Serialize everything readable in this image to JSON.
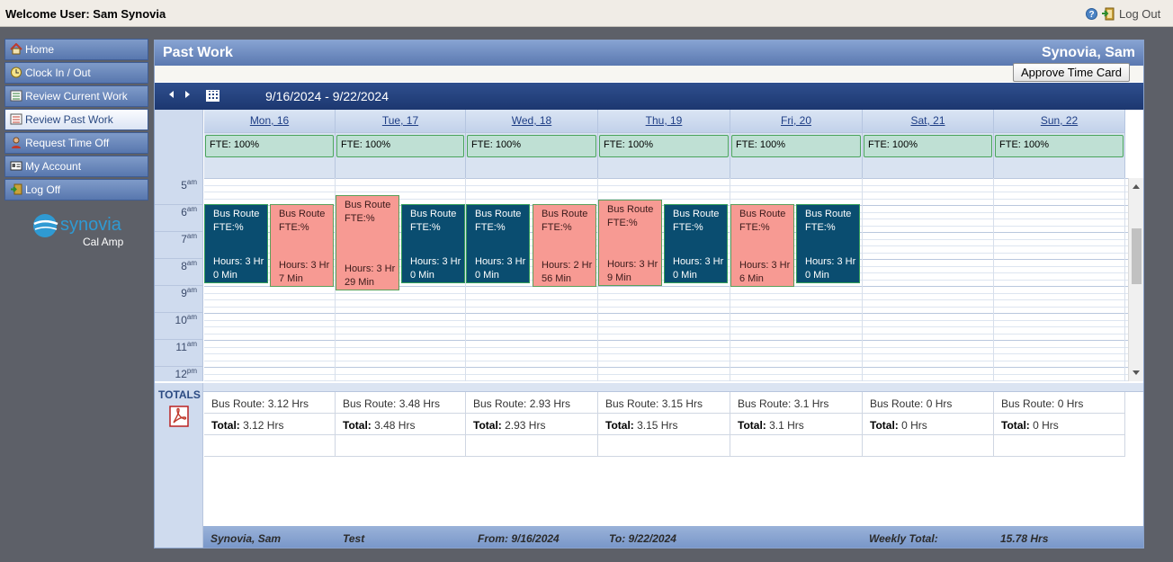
{
  "topbar": {
    "welcome": "Welcome User: Sam Synovia",
    "help_icon": "help-icon",
    "logout_label": "Log Out"
  },
  "nav": {
    "items": [
      {
        "label": "Home",
        "icon": "home-icon",
        "active": false
      },
      {
        "label": "Clock In / Out",
        "icon": "clock-icon",
        "active": false
      },
      {
        "label": "Review Current Work",
        "icon": "worksheet-icon",
        "active": false
      },
      {
        "label": "Review Past Work",
        "icon": "worksheet-icon",
        "active": true
      },
      {
        "label": "Request Time Off",
        "icon": "person-icon",
        "active": false
      },
      {
        "label": "My Account",
        "icon": "id-card-icon",
        "active": false
      },
      {
        "label": "Log Off",
        "icon": "exit-icon",
        "active": false
      }
    ]
  },
  "logo": {
    "brand": "synovia",
    "sub": "Cal Amp"
  },
  "panel": {
    "title": "Past Work",
    "user_name": "Synovia, Sam",
    "approve_label": "Approve Time Card",
    "week_range": "9/16/2024 - 9/22/2024"
  },
  "days": [
    {
      "label": "Mon, 16",
      "fte": "FTE: 100%",
      "total_route": "Bus Route: 3.12 Hrs",
      "total_label": "Total:",
      "total_value": " 3.12 Hrs"
    },
    {
      "label": "Tue, 17",
      "fte": "FTE: 100%",
      "total_route": "Bus Route: 3.48 Hrs",
      "total_label": "Total:",
      "total_value": " 3.48 Hrs"
    },
    {
      "label": "Wed, 18",
      "fte": "FTE: 100%",
      "total_route": "Bus Route: 2.93 Hrs",
      "total_label": "Total:",
      "total_value": " 2.93 Hrs"
    },
    {
      "label": "Thu, 19",
      "fte": "FTE: 100%",
      "total_route": "Bus Route: 3.15 Hrs",
      "total_label": "Total:",
      "total_value": " 3.15 Hrs"
    },
    {
      "label": "Fri, 20",
      "fte": "FTE: 100%",
      "total_route": "Bus Route: 3.1 Hrs",
      "total_label": "Total:",
      "total_value": " 3.1 Hrs"
    },
    {
      "label": "Sat, 21",
      "fte": "FTE: 100%",
      "total_route": "Bus Route: 0 Hrs",
      "total_label": "Total:",
      "total_value": " 0 Hrs"
    },
    {
      "label": "Sun, 22",
      "fte": "FTE: 100%",
      "total_route": "Bus Route: 0 Hrs",
      "total_label": "Total:",
      "total_value": " 0 Hrs"
    }
  ],
  "hours": [
    {
      "h": "5",
      "ampm": "am"
    },
    {
      "h": "6",
      "ampm": "am"
    },
    {
      "h": "7",
      "ampm": "am"
    },
    {
      "h": "8",
      "ampm": "am"
    },
    {
      "h": "9",
      "ampm": "am"
    },
    {
      "h": "10",
      "ampm": "am"
    },
    {
      "h": "11",
      "ampm": "am"
    },
    {
      "h": "12",
      "ampm": "pm"
    }
  ],
  "events": [
    {
      "title": "Bus Route",
      "fte": "FTE:%",
      "hours": "Hours: 3 Hr 0 Min",
      "color": "dark"
    },
    {
      "title": "Bus Route",
      "fte": "FTE:%",
      "hours": "Hours: 3 Hr 7 Min",
      "color": "pink"
    },
    {
      "title": "Bus Route",
      "fte": "FTE:%",
      "hours": "Hours: 3 Hr 29 Min",
      "color": "pink"
    },
    {
      "title": "Bus Route",
      "fte": "FTE:%",
      "hours": "Hours: 3 Hr 0 Min",
      "color": "dark"
    },
    {
      "title": "Bus Route",
      "fte": "FTE:%",
      "hours": "Hours: 3 Hr 0 Min",
      "color": "dark"
    },
    {
      "title": "Bus Route",
      "fte": "FTE:%",
      "hours": "Hours: 2 Hr 56 Min",
      "color": "pink"
    },
    {
      "title": "Bus Route",
      "fte": "FTE:%",
      "hours": "Hours: 3 Hr 9 Min",
      "color": "pink"
    },
    {
      "title": "Bus Route",
      "fte": "FTE:%",
      "hours": "Hours: 3 Hr 0 Min",
      "color": "dark"
    },
    {
      "title": "Bus Route",
      "fte": "FTE:%",
      "hours": "Hours: 3 Hr 6 Min",
      "color": "pink"
    },
    {
      "title": "Bus Route",
      "fte": "FTE:%",
      "hours": "Hours: 3 Hr 0 Min",
      "color": "dark"
    }
  ],
  "totals": {
    "label": "TOTALS",
    "pdf_icon": "pdf-icon"
  },
  "footer": {
    "name": "Synovia, Sam",
    "note": "Test",
    "from": "From: 9/16/2024",
    "to": "To: 9/22/2024",
    "weekly_label": "Weekly Total:",
    "weekly_value": "15.78 Hrs"
  },
  "colors": {
    "event_dark": "#0a4d70",
    "event_pink": "#f79a93",
    "fte_fill": "#bfe0d4",
    "header_blue": "#5a78b0",
    "week_bar": "#1c3770"
  }
}
